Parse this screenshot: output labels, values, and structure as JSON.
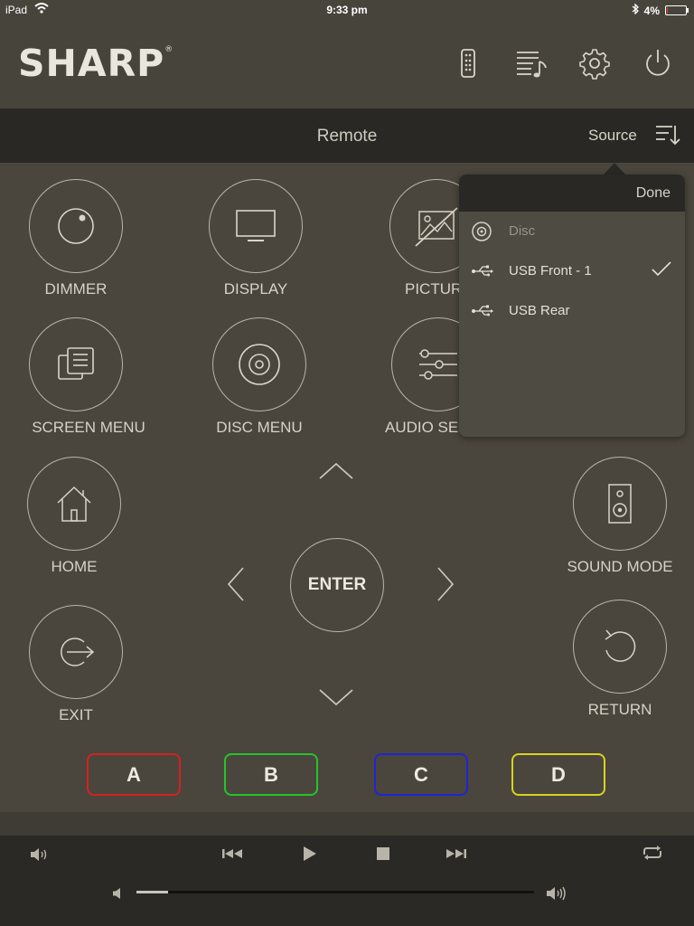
{
  "status_bar": {
    "device": "iPad",
    "time": "9:33 pm",
    "battery": "4%",
    "battery_level": 0.04
  },
  "header": {
    "brand": "SHARP",
    "registered_mark": "®",
    "icons": [
      "remote-icon",
      "playlist-icon",
      "settings-gear-icon",
      "power-icon"
    ]
  },
  "titlebar": {
    "title": "Remote",
    "source_label": "Source"
  },
  "buttons": {
    "dimmer": "DIMMER",
    "display": "DISPLAY",
    "picture": "PICTUR",
    "screen_menu": "SCREEN MENU",
    "disc_menu": "DISC MENU",
    "audio_settings": "AUDIO SE",
    "home": "HOME",
    "sound_mode": "SOUND MODE",
    "exit": "EXIT",
    "return": "RETURN",
    "enter": "ENTER"
  },
  "color_buttons": [
    {
      "label": "A",
      "color": "#d3221f"
    },
    {
      "label": "B",
      "color": "#25c42a"
    },
    {
      "label": "C",
      "color": "#1f24d6"
    },
    {
      "label": "D",
      "color": "#d9d31e"
    }
  ],
  "source_popover": {
    "done_label": "Done",
    "items": [
      {
        "label": "Disc",
        "icon": "disc-icon",
        "enabled": false,
        "selected": false
      },
      {
        "label": "USB Front - 1",
        "icon": "usb-icon",
        "enabled": true,
        "selected": true
      },
      {
        "label": "USB Rear",
        "icon": "usb-icon",
        "enabled": true,
        "selected": false
      }
    ]
  },
  "transport": {
    "controls": [
      "mute-icon",
      "previous-icon",
      "play-icon",
      "stop-icon",
      "next-icon",
      "repeat-icon"
    ],
    "volume_level": 0.08
  }
}
